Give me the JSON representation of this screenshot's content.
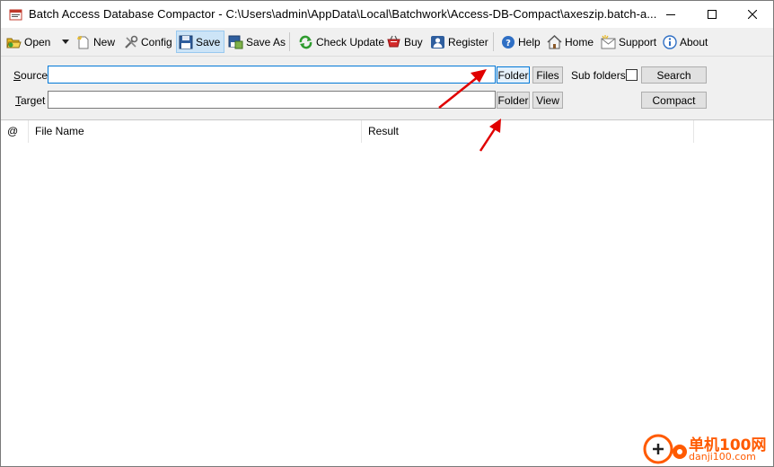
{
  "window": {
    "title": "Batch Access Database Compactor - C:\\Users\\admin\\AppData\\Local\\Batchwork\\Access-DB-Compact\\axeszip.batch-a..."
  },
  "toolbar": {
    "open": "Open",
    "new": "New",
    "config": "Config",
    "save": "Save",
    "save_as": "Save As",
    "check_update": "Check Update",
    "buy": "Buy",
    "register": "Register",
    "help": "Help",
    "home": "Home",
    "support": "Support",
    "about": "About"
  },
  "form": {
    "source_label_u": "S",
    "source_label_rest": "ource",
    "target_label_u": "T",
    "target_label_rest": "arget",
    "source_value": "",
    "target_value": "",
    "source_folder_btn": "Folder",
    "source_files_btn": "Files",
    "subfolders_label": "Sub folders",
    "subfolders_checked": false,
    "target_folder_btn": "Folder",
    "target_view_btn": "View",
    "search_btn": "Search",
    "compact_btn": "Compact"
  },
  "table": {
    "columns": [
      "@",
      "File Name",
      "Result"
    ],
    "rows": []
  },
  "watermark": {
    "line1": "单机100网",
    "line2": "danji100.com"
  },
  "colors": {
    "accent": "#0078d7",
    "toolbar_bg": "#f0f0f0",
    "arrow": "#e00000",
    "watermark": "#ff5a00"
  }
}
